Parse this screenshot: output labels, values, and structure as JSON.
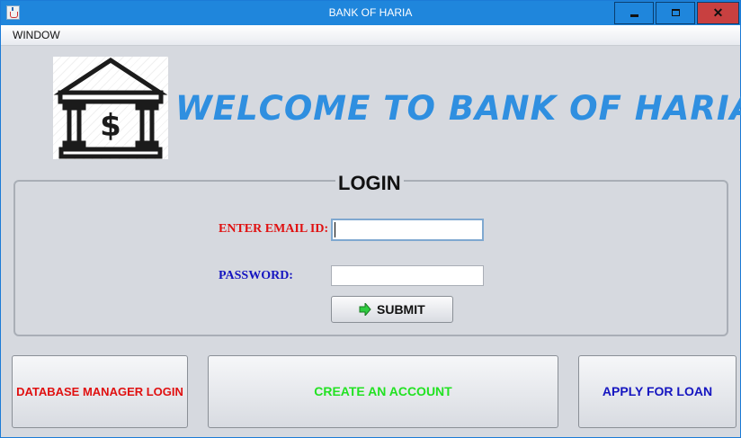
{
  "window": {
    "title": "BANK OF HARIA",
    "close_glyph": "✕"
  },
  "menu": {
    "items": [
      "WINDOW"
    ]
  },
  "header": {
    "logo_icon": "bank-icon",
    "welcome_text": "WELCOME TO BANK OF HARIA"
  },
  "login": {
    "title": "LOGIN",
    "email_label": "ENTER EMAIL ID:",
    "email_value": "",
    "password_label": "PASSWORD:",
    "password_value": "",
    "submit_label": "SUBMIT",
    "submit_icon": "arrow-right-icon"
  },
  "actions": {
    "database_manager_login": "DATABASE MANAGER LOGIN",
    "create_account": "CREATE AN ACCOUNT",
    "apply_loan": "APPLY FOR LOAN"
  },
  "colors": {
    "accent_blue": "#2f8fe0",
    "label_red": "#e01010",
    "label_blue": "#1515c0",
    "create_green": "#22e222"
  }
}
